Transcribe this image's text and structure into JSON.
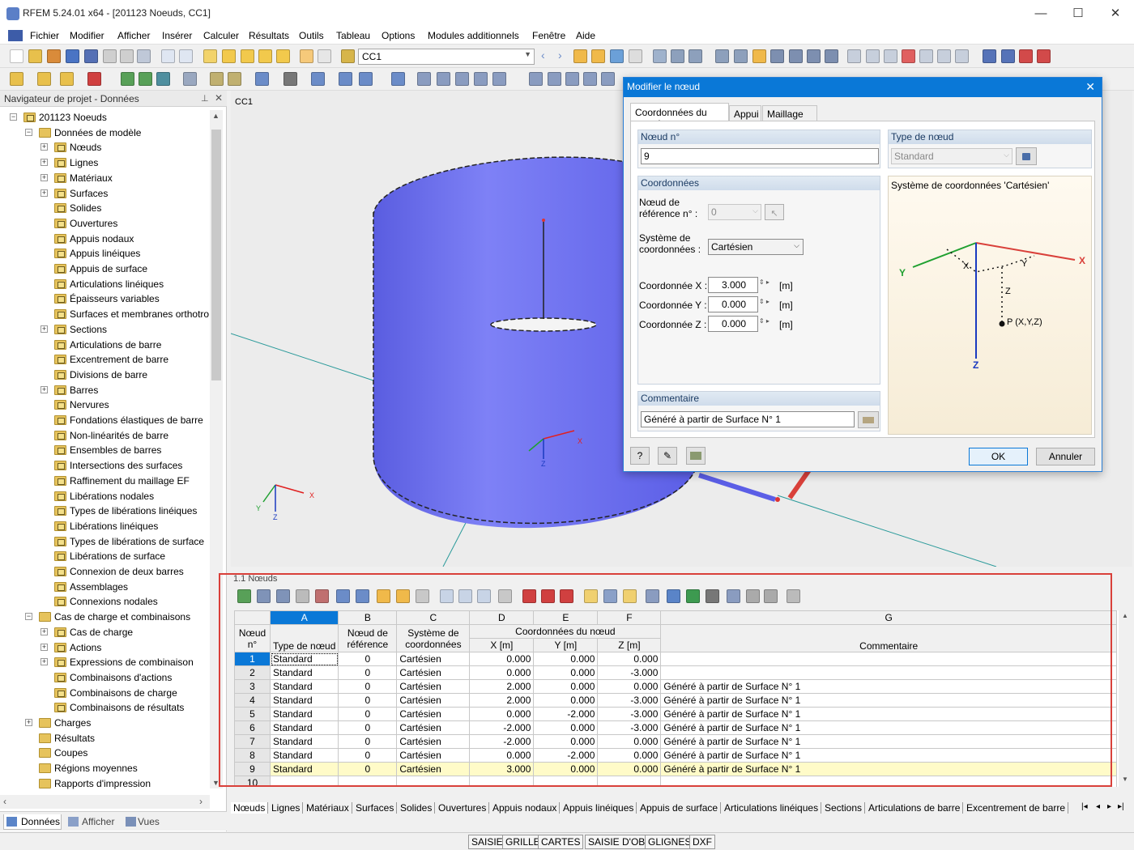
{
  "window": {
    "title": "RFEM 5.24.01 x64 - [201123 Noeuds, CC1]",
    "minimize": "—",
    "maximize": "☐",
    "close": "✕"
  },
  "menu": [
    "Fichier",
    "Modifier",
    "Afficher",
    "Insérer",
    "Calculer",
    "Résultats",
    "Outils",
    "Tableau",
    "Options",
    "Modules additionnels",
    "Fenêtre",
    "Aide"
  ],
  "toolbar": {
    "load_case": "CC1"
  },
  "navigator": {
    "title": "Navigateur de projet - Données",
    "root": "201123 Noeuds",
    "model_data": "Données de modèle",
    "model_items": [
      "Nœuds",
      "Lignes",
      "Matériaux",
      "Surfaces",
      "Solides",
      "Ouvertures",
      "Appuis nodaux",
      "Appuis linéiques",
      "Appuis de surface",
      "Articulations linéiques",
      "Épaisseurs variables",
      "Surfaces et membranes orthotro",
      "Sections",
      "Articulations de barre",
      "Excentrement de barre",
      "Divisions de barre",
      "Barres",
      "Nervures",
      "Fondations élastiques de barre",
      "Non-linéarités de barre",
      "Ensembles de barres",
      "Intersections des surfaces",
      "Raffinement du maillage EF",
      "Libérations nodales",
      "Types de libérations linéiques",
      "Libérations linéiques",
      "Types de libérations de surface",
      "Libérations de surface",
      "Connexion de deux barres",
      "Assemblages",
      "Connexions nodales"
    ],
    "load_cases": "Cas de charge et combinaisons",
    "load_items": [
      "Cas de charge",
      "Actions",
      "Expressions de combinaison",
      "Combinaisons d'actions",
      "Combinaisons de charge",
      "Combinaisons de résultats"
    ],
    "other_items": [
      "Charges",
      "Résultats",
      "Coupes",
      "Régions moyennes",
      "Rapports d'impression"
    ],
    "bottom_tabs": [
      "Données",
      "Afficher",
      "Vues"
    ]
  },
  "view": {
    "label": "CC1",
    "axes": {
      "x": "X",
      "y": "Y",
      "z": "Z"
    }
  },
  "dialog": {
    "title": "Modifier le nœud",
    "tabs": [
      "Coordonnées du nœud",
      "Appui",
      "Maillage EF"
    ],
    "node_no_label": "Nœud n°",
    "node_no": "9",
    "node_type_label": "Type de nœud",
    "node_type": "Standard",
    "coords_label": "Coordonnées",
    "ref_node_label_1": "Nœud de",
    "ref_node_label_2": "référence n° :",
    "ref_node": "0",
    "cs_label_1": "Système de",
    "cs_label_2": "coordonnées :",
    "cs_value": "Cartésien",
    "x_label": "Coordonnée X :",
    "y_label": "Coordonnée Y :",
    "z_label": "Coordonnée Z :",
    "x": "3.000",
    "y": "0.000",
    "z": "0.000",
    "unit": "[m]",
    "cs_title": "Système de coordonnées 'Cartésien'",
    "cs_point": "P (X,Y,Z)",
    "comment_label": "Commentaire",
    "comment": "Généré à partir de Surface N° 1",
    "ok": "OK",
    "cancel": "Annuler"
  },
  "table": {
    "title": "1.1 Nœuds",
    "col_letters": [
      "A",
      "B",
      "C",
      "D",
      "E",
      "F",
      "G"
    ],
    "h_node_1": "Nœud",
    "h_node_2": "n°",
    "h_type": "Type de nœud",
    "h_ref_1": "Nœud de",
    "h_ref_2": "référence",
    "h_cs_1": "Système de",
    "h_cs_2": "coordonnées",
    "h_coords": "Coordonnées du nœud",
    "h_x": "X [m]",
    "h_y": "Y [m]",
    "h_z": "Z [m]",
    "h_comment": "Commentaire",
    "rows": [
      [
        "1",
        "Standard",
        "0",
        "Cartésien",
        "0.000",
        "0.000",
        "0.000",
        ""
      ],
      [
        "2",
        "Standard",
        "0",
        "Cartésien",
        "0.000",
        "0.000",
        "-3.000",
        ""
      ],
      [
        "3",
        "Standard",
        "0",
        "Cartésien",
        "2.000",
        "0.000",
        "0.000",
        "Généré à partir de Surface N° 1"
      ],
      [
        "4",
        "Standard",
        "0",
        "Cartésien",
        "2.000",
        "0.000",
        "-3.000",
        "Généré à partir de Surface N° 1"
      ],
      [
        "5",
        "Standard",
        "0",
        "Cartésien",
        "0.000",
        "-2.000",
        "-3.000",
        "Généré à partir de Surface N° 1"
      ],
      [
        "6",
        "Standard",
        "0",
        "Cartésien",
        "-2.000",
        "0.000",
        "-3.000",
        "Généré à partir de Surface N° 1"
      ],
      [
        "7",
        "Standard",
        "0",
        "Cartésien",
        "-2.000",
        "0.000",
        "0.000",
        "Généré à partir de Surface N° 1"
      ],
      [
        "8",
        "Standard",
        "0",
        "Cartésien",
        "0.000",
        "-2.000",
        "0.000",
        "Généré à partir de Surface N° 1"
      ],
      [
        "9",
        "Standard",
        "0",
        "Cartésien",
        "3.000",
        "0.000",
        "0.000",
        "Généré à partir de Surface N° 1"
      ],
      [
        "10",
        "",
        "",
        "",
        "",
        "",
        "",
        ""
      ]
    ],
    "tabs": [
      "Nœuds",
      "Lignes",
      "Matériaux",
      "Surfaces",
      "Solides",
      "Ouvertures",
      "Appuis nodaux",
      "Appuis linéiques",
      "Appuis de surface",
      "Articulations linéiques",
      "Sections",
      "Articulations de barre",
      "Excentrement de barre"
    ]
  },
  "status": [
    "SAISIE",
    "GRILLE",
    "CARTES",
    "SAISIE D'OB.",
    "GLIGNES",
    "DXF"
  ],
  "colors": {
    "accent": "#0a78d7",
    "cylinder": "#6a6df2",
    "highlight": "#d9403a",
    "selected_row": "#fffbc8"
  }
}
